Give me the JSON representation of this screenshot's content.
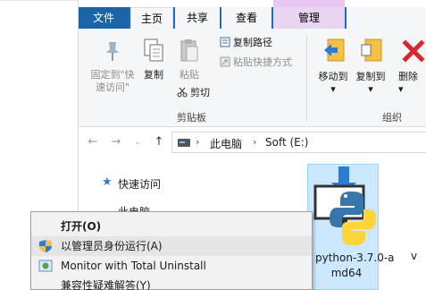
{
  "ribbon": {
    "tabs": {
      "file": "文件",
      "home": "主页",
      "share": "共享",
      "view": "查看",
      "manage": "管理"
    },
    "pin_label_1": "固定到\"快",
    "pin_label_2": "速访问\"",
    "copy": "复制",
    "paste": "粘贴",
    "copy_path": "复制路径",
    "paste_shortcut": "粘贴快捷方式",
    "cut": "剪切",
    "clipboard_group": "剪贴板",
    "move_to": "移动到",
    "copy_to": "复制到",
    "delete": "删除",
    "organize_group": "组织"
  },
  "address": {
    "crumbs": [
      "此电脑",
      "Soft (E:)"
    ]
  },
  "nav": {
    "quick_access": "快速访问",
    "this_pc": "此电脑"
  },
  "files": [
    {
      "name_line1": "python-3.7.0-a",
      "name_line2": "md64"
    },
    {
      "name_line1": "v"
    }
  ],
  "context_menu": {
    "items": [
      {
        "label": "打开(O)",
        "bold": true
      },
      {
        "label": "以管理员身份运行(A)",
        "bold": false
      },
      {
        "label": "Monitor with Total Uninstall",
        "bold": false
      },
      {
        "label": "兼容性疑难解答(Y)",
        "bold": false
      }
    ]
  },
  "colors": {
    "tab_blue": "#1f6fb6",
    "selection": "#cce8ff",
    "manage_accent": "#e8d5f2",
    "delete_red": "#d9252c"
  }
}
